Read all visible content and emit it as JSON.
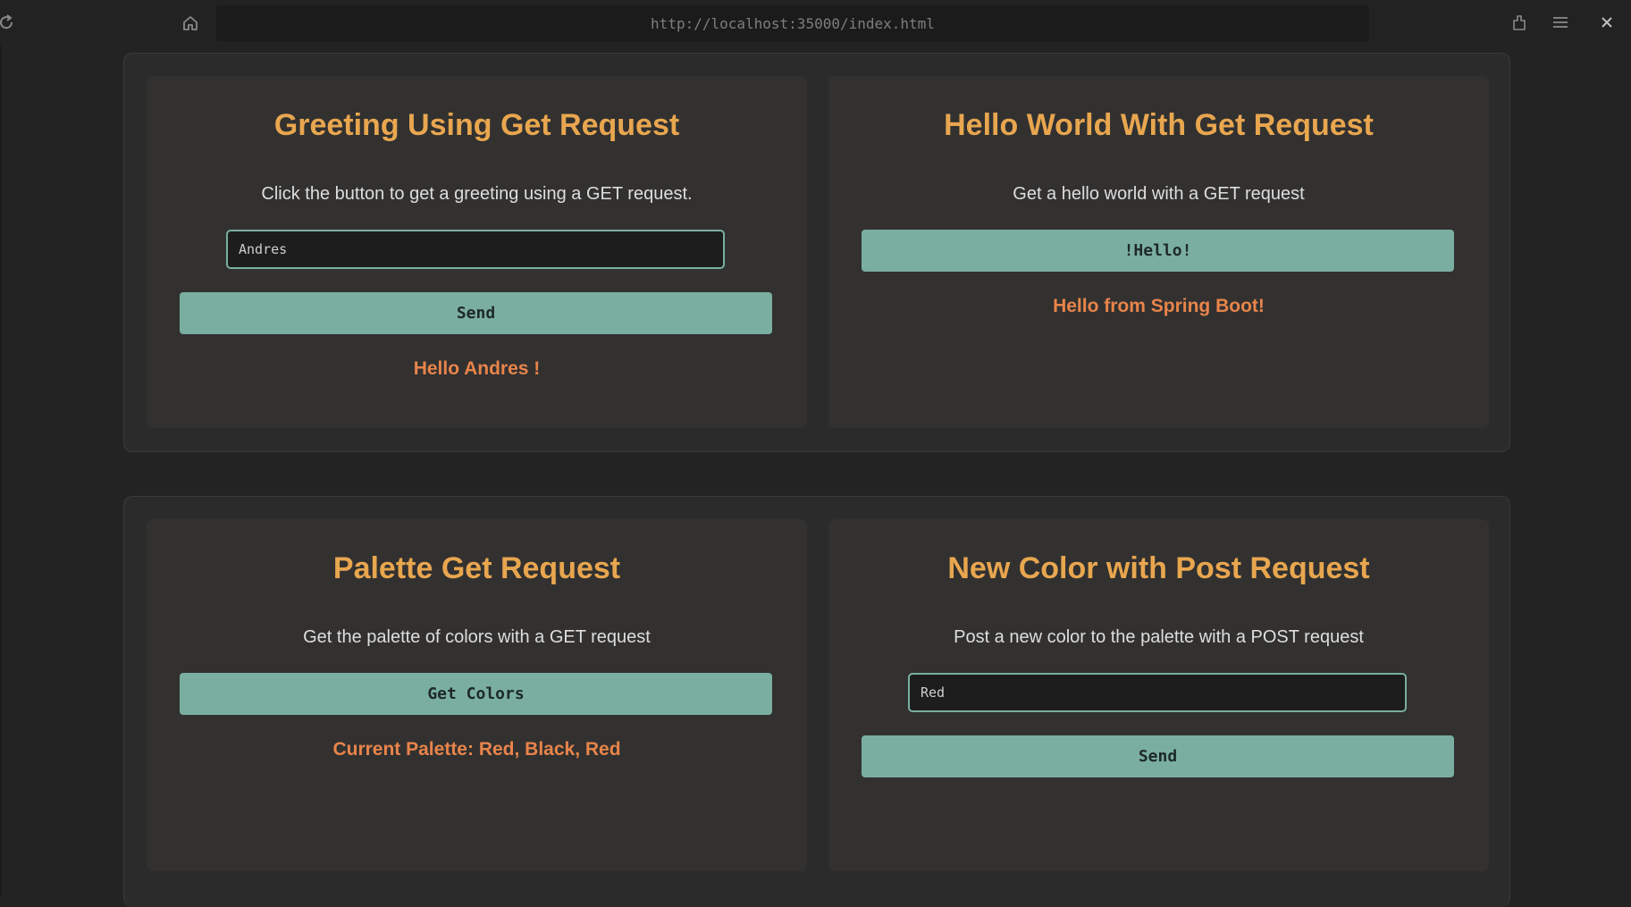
{
  "browser": {
    "url": "http://localhost:35000/index.html",
    "icons": {
      "reload": "reload-icon",
      "home": "home-icon",
      "extensions": "extensions-icon",
      "menu": "hamburger-menu-icon",
      "close": "close-icon"
    }
  },
  "cards": {
    "greeting": {
      "title": "Greeting Using Get Request",
      "description": "Click the button to get a greeting using a GET request.",
      "input_value": "Andres",
      "button_label": "Send",
      "result": "Hello Andres !"
    },
    "hello_world": {
      "title": "Hello World With Get Request",
      "description": "Get a hello world with a GET request",
      "button_label": "!Hello!",
      "result": "Hello from Spring Boot!"
    },
    "palette": {
      "title": "Palette Get Request",
      "description": "Get the palette of colors with a GET request",
      "button_label": "Get Colors",
      "result": "Current Palette: Red, Black, Red"
    },
    "new_color": {
      "title": "New Color with Post Request",
      "description": "Post a new color to the palette with a POST request",
      "input_value": "Red",
      "button_label": "Send"
    }
  },
  "colors": {
    "accent": "#7aaea1",
    "title": "#e8a64f",
    "result": "#e8844a",
    "background": "#232323",
    "card": "#323130"
  }
}
